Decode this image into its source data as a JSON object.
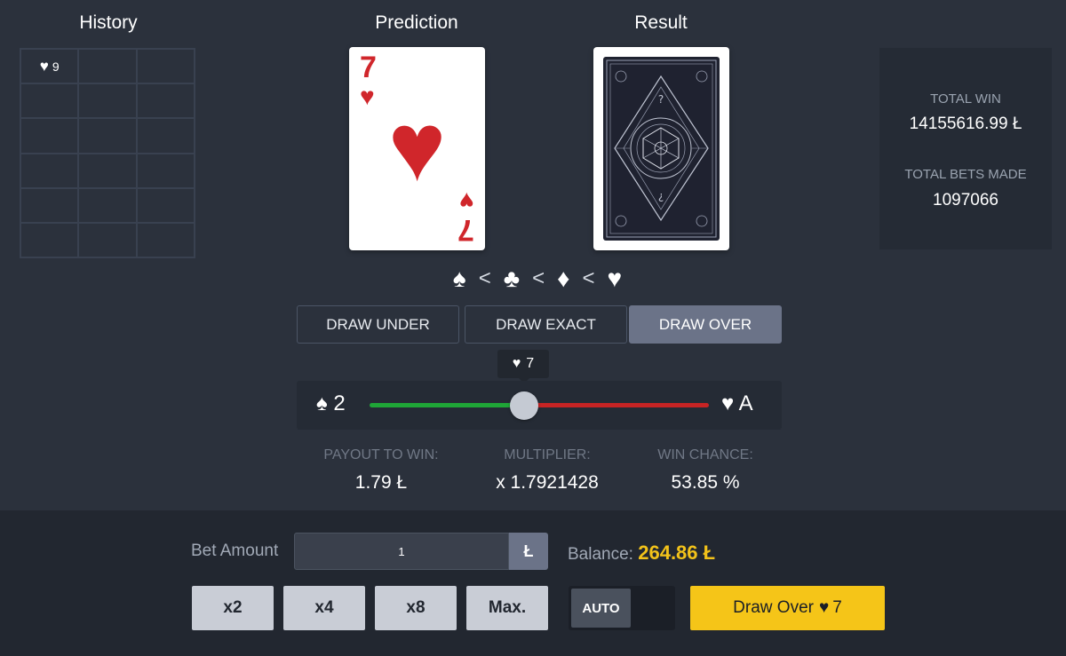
{
  "headings": {
    "history": "History",
    "prediction": "Prediction",
    "result": "Result"
  },
  "history": {
    "entries": [
      {
        "suit": "♥",
        "value": "9"
      }
    ]
  },
  "prediction_card": {
    "rank": "7",
    "suit": "♥",
    "color": "#d0262b"
  },
  "result_card": {
    "face": "back"
  },
  "stats": {
    "total_win_label": "TOTAL WIN",
    "total_win_value": "14155616.99 Ł",
    "total_bets_label": "TOTAL BETS MADE",
    "total_bets_value": "1097066"
  },
  "suit_order": {
    "spade": "♠",
    "club": "♣",
    "diamond": "♦",
    "heart": "♥",
    "separator": "<"
  },
  "draw_modes": {
    "under": "DRAW UNDER",
    "exact": "DRAW EXACT",
    "over": "DRAW OVER",
    "active": "over"
  },
  "slider": {
    "tooltip_suit": "♥",
    "tooltip_value": "7",
    "min_suit": "♠",
    "min_value": "2",
    "max_suit": "♥",
    "max_value": "A",
    "colors": {
      "under": "#1fa637",
      "over": "#c72424"
    }
  },
  "payout": {
    "payout_label": "PAYOUT TO WIN:",
    "payout_value": "1.79 Ł",
    "multiplier_label": "MULTIPLIER:",
    "multiplier_value": "x 1.7921428",
    "chance_label": "WIN CHANCE:",
    "chance_value": "53.85 %"
  },
  "bet": {
    "label": "Bet Amount",
    "amount": "1",
    "currency": "Ł",
    "balance_label": "Balance:",
    "balance_value": "264.86 Ł",
    "multipliers": [
      "x2",
      "x4",
      "x8",
      "Max."
    ],
    "auto_label": "AUTO",
    "action_label": "Draw Over",
    "action_suit": "♥",
    "action_value": "7",
    "accent_color": "#f5c518"
  }
}
